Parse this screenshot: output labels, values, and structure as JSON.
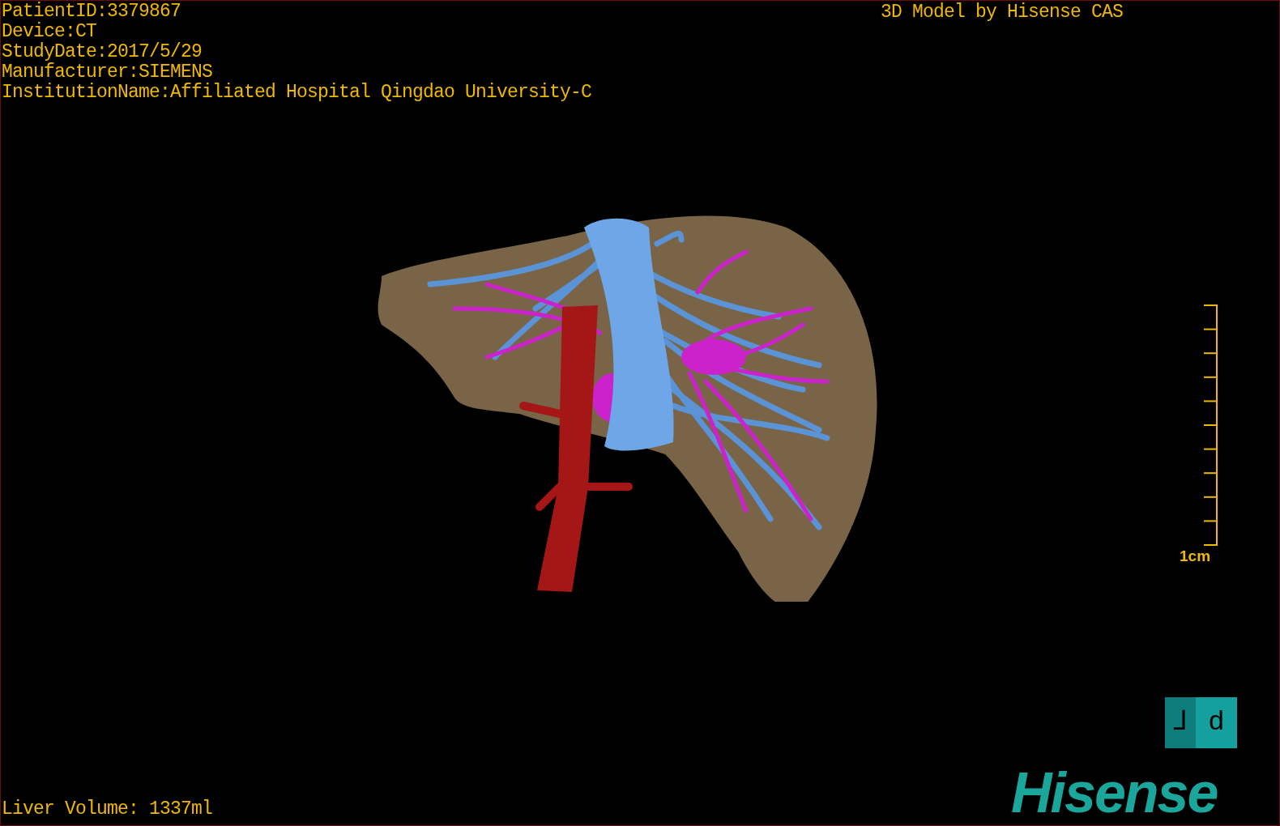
{
  "study_info": [
    "PatientID:3379867",
    "Device:CT",
    "StudyDate:2017/5/29",
    "Manufacturer:SIEMENS",
    "InstitutionName:Affiliated Hospital Qingdao University-C"
  ],
  "watermark_title": "3D Model by Hisense CAS",
  "scale_bar": {
    "label": "1cm"
  },
  "orientation_cube": {
    "faces": [
      "⅃",
      "d"
    ]
  },
  "liver_volume": "Liver Volume: 1337ml",
  "brand": "Hisense"
}
